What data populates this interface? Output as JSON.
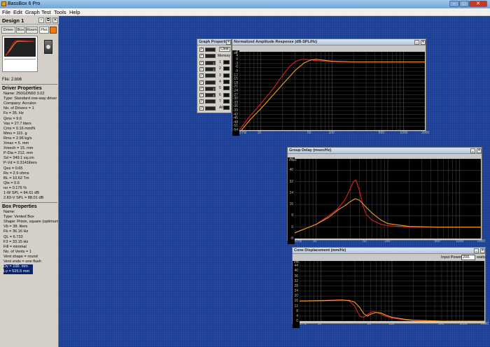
{
  "app": {
    "title": "BassBox 6 Pro"
  },
  "menu": [
    "File",
    "Edit",
    "Graph",
    "Test",
    "Tools",
    "Help"
  ],
  "design": {
    "title": "Design 1",
    "tabs": [
      "Driver",
      "Box",
      "Room",
      "Plot"
    ],
    "file_label": "File: 2.bb6"
  },
  "driver_properties": {
    "heading": "Driver Properties",
    "lines": [
      "Name: 250GDN93 3.02",
      "Type: Standard one-way driver",
      "Company: Acculon",
      "No. of Drivers = 1",
      "Fs = 35. Hz",
      "Qms = 9.6",
      "Vas = 27.7 liters",
      "Cms = 0.16 mm/N",
      "Mms = 115. g",
      "Rms = 2.96 kg/s",
      "Xmax = 5. mm",
      "Xmech = 15. mm",
      "P-Dia = 212. mm",
      "Sd = 349.1 sq.cm",
      "P-Vd = 0.3141liters",
      "Qes = 0.65",
      "Re = 2.9 ohms",
      "BL = 10.62 Tm",
      "Qts = 0.6",
      "no = 0.176 %",
      "1-W SPL = 84.61 dB",
      "2.83-V SPL = 88.01 dB"
    ]
  },
  "box_properties": {
    "heading": "Box Properties",
    "lines": [
      "Name:",
      "Type: Vented Box",
      "Shape: Prism, square (optimum)",
      "Vb = 38. liters",
      "Fb = 36.16 Hz",
      "QL = 6.733",
      "F3 = 33.15 Hz",
      "Fill = minimal",
      "No. of Vents = 1",
      "Vent shape = round",
      "Vent ends = one flush"
    ],
    "selected_lines": [
      "Dv = 100. mm",
      "Lv = 525.5 mm"
    ]
  },
  "graph_properties": {
    "title": "Graph Properties",
    "clear_label": "Clear",
    "memory_label": "Memory",
    "row_labels": [
      "",
      "",
      "1",
      "2",
      "",
      "",
      "3",
      "4",
      "",
      ""
    ],
    "memory_slots": [
      "1",
      "2",
      "3",
      "4",
      "5",
      "6",
      "7",
      "All"
    ]
  },
  "colors": {
    "curve_primary": "#e02020",
    "curve_secondary": "#f0a020",
    "grid": "#3a3a3a",
    "background": "#1c3f96"
  },
  "graphs": [
    {
      "title": "Normalized Amplitude Response (dB-SPL/Hz)",
      "y_unit": "dB",
      "y_ticks": [
        "8",
        "4",
        "0",
        "-3",
        "-6",
        "-9",
        "-12",
        "-15",
        "-18",
        "-21",
        "-24",
        "-27",
        "-30",
        "-33",
        "-36",
        "-39",
        "-42",
        "-45",
        "-48",
        "-51",
        "-54"
      ],
      "x_ticks": [
        "5 Hz",
        "10",
        "50",
        "100",
        "500",
        "1000",
        "2000"
      ],
      "input_power_label": "",
      "input_power_value": "",
      "input_power_unit": ""
    },
    {
      "title": "Group Delay (msec/Hz)",
      "y_unit": "msec",
      "y_ticks": [
        "48",
        "40",
        "32",
        "24",
        "16",
        "8",
        "0",
        "-8"
      ],
      "x_ticks": [
        "5 Hz",
        "10",
        "50",
        "100",
        "500",
        "1000",
        "2000"
      ],
      "input_power_label": "",
      "input_power_value": "",
      "input_power_unit": ""
    },
    {
      "title": "Cone Displacement (mm/Hz)",
      "y_unit": "mm",
      "y_ticks": [
        "48",
        "44",
        "40",
        "36",
        "32",
        "28",
        "24",
        "20",
        "16",
        "12",
        "8",
        "4",
        "0"
      ],
      "x_ticks": [
        "5 Hz",
        "10",
        "50",
        "100",
        "500",
        "1000",
        "2000"
      ],
      "input_power_label": "Input Power:",
      "input_power_value": "200.",
      "input_power_unit": "watts"
    }
  ],
  "chart_data": [
    {
      "type": "line",
      "title": "Normalized Amplitude Response (dB-SPL/Hz)",
      "xlabel": "Hz",
      "ylabel": "dB",
      "xscale": "log",
      "xlim": [
        5,
        2000
      ],
      "ylim": [
        -54,
        8
      ],
      "grid": true,
      "series": [
        {
          "color": "#e02020",
          "x": [
            5,
            7,
            10,
            15,
            20,
            25,
            30,
            35,
            40,
            50,
            60,
            80,
            100,
            200,
            500,
            1000,
            2000
          ],
          "y": [
            -54,
            -43,
            -33,
            -21,
            -11,
            -4,
            0,
            1.5,
            2,
            1.5,
            1,
            0.4,
            0.2,
            0,
            0,
            0,
            0
          ]
        },
        {
          "color": "#f0a020",
          "x": [
            5,
            7,
            10,
            15,
            20,
            25,
            30,
            40,
            50,
            60,
            80,
            100,
            200,
            500,
            1000,
            2000
          ],
          "y": [
            -56,
            -46,
            -37,
            -26,
            -18,
            -12,
            -7,
            -1,
            1.5,
            2,
            1.2,
            0.5,
            0,
            0,
            0,
            0
          ]
        }
      ]
    },
    {
      "type": "line",
      "title": "Group Delay (msec/Hz)",
      "xlabel": "Hz",
      "ylabel": "msec",
      "xscale": "log",
      "xlim": [
        5,
        2000
      ],
      "ylim": [
        -8,
        48
      ],
      "grid": true,
      "series": [
        {
          "color": "#e02020",
          "x": [
            5,
            10,
            15,
            20,
            25,
            30,
            33,
            36,
            40,
            45,
            50,
            60,
            80,
            100,
            200,
            500,
            2000
          ],
          "y": [
            -4,
            2,
            8,
            13,
            19,
            27,
            32,
            33,
            26,
            15,
            9,
            5,
            2,
            1,
            0.2,
            0,
            0
          ]
        },
        {
          "color": "#f0a020",
          "x": [
            5,
            10,
            15,
            20,
            25,
            30,
            35,
            40,
            50,
            60,
            80,
            100,
            200,
            500,
            2000
          ],
          "y": [
            -4,
            2,
            7,
            12,
            15,
            18,
            20,
            19,
            14,
            10,
            5,
            2.5,
            0.5,
            0,
            0
          ]
        }
      ]
    },
    {
      "type": "line",
      "title": "Cone Displacement (mm/Hz)",
      "xlabel": "Hz",
      "ylabel": "mm",
      "xscale": "log",
      "xlim": [
        5,
        2000
      ],
      "ylim": [
        0,
        48
      ],
      "grid": true,
      "series": [
        {
          "color": "#e02020",
          "x": [
            5,
            10,
            20,
            25,
            30,
            33,
            36,
            40,
            45,
            50,
            55,
            60,
            70,
            80,
            100,
            150,
            200,
            500,
            2000
          ],
          "y": [
            16,
            16.5,
            17,
            16,
            12,
            7,
            3.5,
            3,
            5,
            7,
            7.5,
            7,
            5.5,
            4,
            2.5,
            1,
            0.5,
            0,
            0
          ]
        },
        {
          "color": "#f0a020",
          "x": [
            5,
            10,
            20,
            25,
            30,
            35,
            40,
            45,
            50,
            60,
            70,
            80,
            100,
            150,
            200,
            500,
            2000
          ],
          "y": [
            16,
            16.3,
            16.8,
            16.5,
            15,
            11,
            6,
            4,
            5.5,
            7,
            6.5,
            5,
            3,
            1.5,
            0.7,
            0,
            0
          ]
        }
      ]
    }
  ]
}
